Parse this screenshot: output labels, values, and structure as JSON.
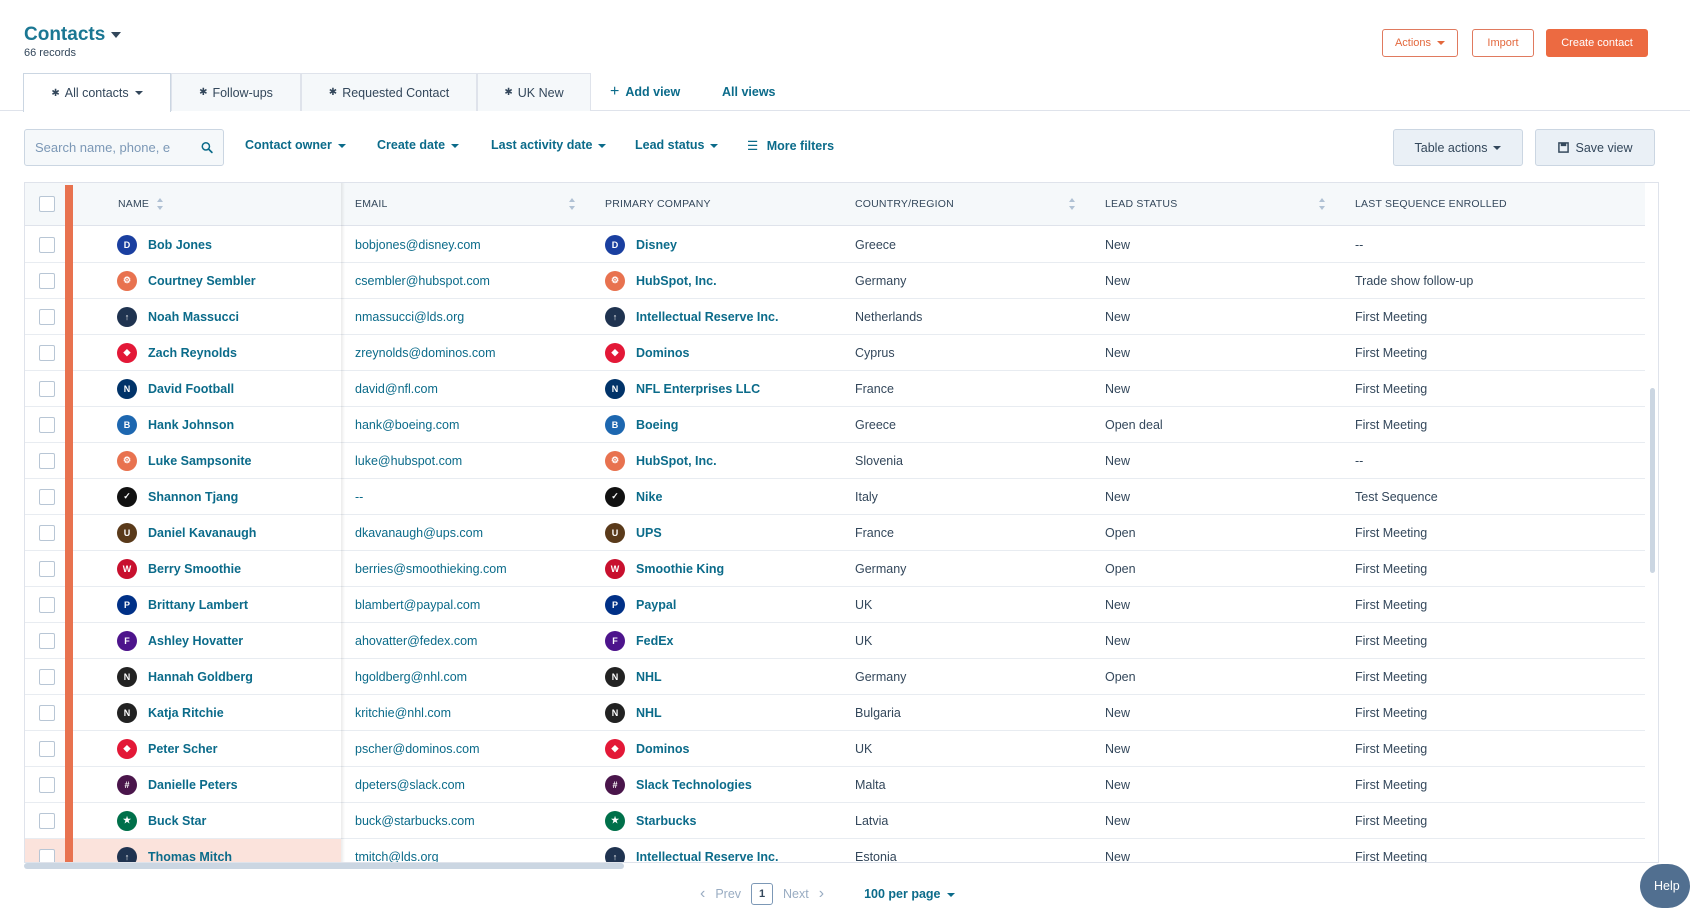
{
  "header": {
    "title": "Contacts",
    "record_count": "66 records",
    "actions_label": "Actions",
    "import_label": "Import",
    "create_label": "Create contact"
  },
  "tabs": [
    {
      "label": "All contacts",
      "active": true
    },
    {
      "label": "Follow-ups"
    },
    {
      "label": "Requested Contact"
    },
    {
      "label": "UK New"
    }
  ],
  "tab_links": {
    "add_view": "Add view",
    "all_views": "All views"
  },
  "filters": {
    "search_placeholder": "Search name, phone, e",
    "contact_owner": "Contact owner",
    "create_date": "Create date",
    "last_activity_date": "Last activity date",
    "lead_status": "Lead status",
    "more_filters": "More filters",
    "table_actions": "Table actions",
    "save_view": "Save view"
  },
  "table": {
    "columns": [
      "NAME",
      "EMAIL",
      "PRIMARY COMPANY",
      "COUNTRY/REGION",
      "LEAD STATUS",
      "LAST SEQUENCE ENROLLED"
    ],
    "rows": [
      {
        "name": "Bob Jones",
        "email": "bobjones@disney.com",
        "company": "Disney",
        "country": "Greece",
        "lead_status": "New",
        "sequence": "--",
        "logo": "disney",
        "logo_color": "#1a3fa0"
      },
      {
        "name": "Courtney Sembler",
        "email": "csembler@hubspot.com",
        "company": "HubSpot, Inc.",
        "country": "Germany",
        "lead_status": "New",
        "sequence": "Trade show follow-up",
        "logo": "hubspot",
        "logo_color": "#e8724f"
      },
      {
        "name": "Noah Massucci",
        "email": "nmassucci@lds.org",
        "company": "Intellectual Reserve Inc.",
        "country": "Netherlands",
        "lead_status": "New",
        "sequence": "First Meeting",
        "logo": "lds",
        "logo_color": "#1f3350"
      },
      {
        "name": "Zach Reynolds",
        "email": "zreynolds@dominos.com",
        "company": "Dominos",
        "country": "Cyprus",
        "lead_status": "New",
        "sequence": "First Meeting",
        "logo": "dominos",
        "logo_color": "#e31837"
      },
      {
        "name": "David Football",
        "email": "david@nfl.com",
        "company": "NFL Enterprises LLC",
        "country": "France",
        "lead_status": "New",
        "sequence": "First Meeting",
        "logo": "nfl",
        "logo_color": "#013369"
      },
      {
        "name": "Hank Johnson",
        "email": "hank@boeing.com",
        "company": "Boeing",
        "country": "Greece",
        "lead_status": "Open deal",
        "sequence": "First Meeting",
        "logo": "boeing",
        "logo_color": "#1d67b0"
      },
      {
        "name": "Luke Sampsonite",
        "email": "luke@hubspot.com",
        "company": "HubSpot, Inc.",
        "country": "Slovenia",
        "lead_status": "New",
        "sequence": "--",
        "logo": "hubspot",
        "logo_color": "#e8724f"
      },
      {
        "name": "Shannon Tjang",
        "email": "--",
        "company": "Nike",
        "country": "Italy",
        "lead_status": "New",
        "sequence": "Test Sequence",
        "logo": "nike",
        "logo_color": "#111111"
      },
      {
        "name": "Daniel Kavanaugh",
        "email": "dkavanaugh@ups.com",
        "company": "UPS",
        "country": "France",
        "lead_status": "Open",
        "sequence": "First Meeting",
        "logo": "ups",
        "logo_color": "#5a3a1a"
      },
      {
        "name": "Berry Smoothie",
        "email": "berries@smoothieking.com",
        "company": "Smoothie King",
        "country": "Germany",
        "lead_status": "Open",
        "sequence": "First Meeting",
        "logo": "smoothieking",
        "logo_color": "#c8102e"
      },
      {
        "name": "Brittany Lambert",
        "email": "blambert@paypal.com",
        "company": "Paypal",
        "country": "UK",
        "lead_status": "New",
        "sequence": "First Meeting",
        "logo": "paypal",
        "logo_color": "#003087"
      },
      {
        "name": "Ashley Hovatter",
        "email": "ahovatter@fedex.com",
        "company": "FedEx",
        "country": "UK",
        "lead_status": "New",
        "sequence": "First Meeting",
        "logo": "fedex",
        "logo_color": "#4d148c"
      },
      {
        "name": "Hannah Goldberg",
        "email": "hgoldberg@nhl.com",
        "company": "NHL",
        "country": "Germany",
        "lead_status": "Open",
        "sequence": "First Meeting",
        "logo": "nhl",
        "logo_color": "#222222"
      },
      {
        "name": "Katja Ritchie",
        "email": "kritchie@nhl.com",
        "company": "NHL",
        "country": "Bulgaria",
        "lead_status": "New",
        "sequence": "First Meeting",
        "logo": "nhl",
        "logo_color": "#222222"
      },
      {
        "name": "Peter Scher",
        "email": "pscher@dominos.com",
        "company": "Dominos",
        "country": "UK",
        "lead_status": "New",
        "sequence": "First Meeting",
        "logo": "dominos",
        "logo_color": "#e31837"
      },
      {
        "name": "Danielle Peters",
        "email": "dpeters@slack.com",
        "company": "Slack Technologies",
        "country": "Malta",
        "lead_status": "New",
        "sequence": "First Meeting",
        "logo": "slack",
        "logo_color": "#4a154b"
      },
      {
        "name": "Buck Star",
        "email": "buck@starbucks.com",
        "company": "Starbucks",
        "country": "Latvia",
        "lead_status": "New",
        "sequence": "First Meeting",
        "logo": "starbucks",
        "logo_color": "#00704a"
      },
      {
        "name": "Thomas Mitch",
        "email": "tmitch@lds.org",
        "company": "Intellectual Reserve Inc.",
        "country": "Estonia",
        "lead_status": "New",
        "sequence": "First Meeting",
        "logo": "lds",
        "logo_color": "#1f3350"
      }
    ]
  },
  "pagination": {
    "prev": "Prev",
    "page": "1",
    "next": "Next",
    "per_page": "100 per page"
  },
  "help_label": "Help",
  "colors": {
    "accent": "#ec6a41",
    "link": "#0b6b8a",
    "freeze": "#e8724f"
  }
}
